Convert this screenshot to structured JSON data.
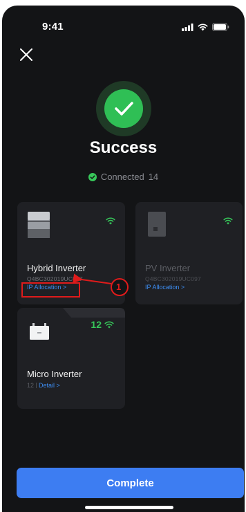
{
  "status_bar": {
    "time": "9:41"
  },
  "header": {
    "title": "Success",
    "connected_label": "Connected",
    "connected_count": "14"
  },
  "devices": [
    {
      "name": "Hybrid Inverter",
      "serial": "Q4BC302019UC097",
      "link": "IP Allocation >"
    },
    {
      "name": "PV Inverter",
      "serial": "Q4BC302019UC097",
      "link": "IP Allocation >"
    },
    {
      "name": "Micro Inverter",
      "count": "12",
      "sub_count": "12",
      "link": "Detail >"
    }
  ],
  "annotation": {
    "label": "1",
    "color": "#e01b1b"
  },
  "footer": {
    "complete_label": "Complete"
  },
  "colors": {
    "accent": "#3d7df2",
    "success": "#37c75a",
    "link": "#3c8cf0",
    "background": "#131416",
    "card": "#1f2024"
  }
}
